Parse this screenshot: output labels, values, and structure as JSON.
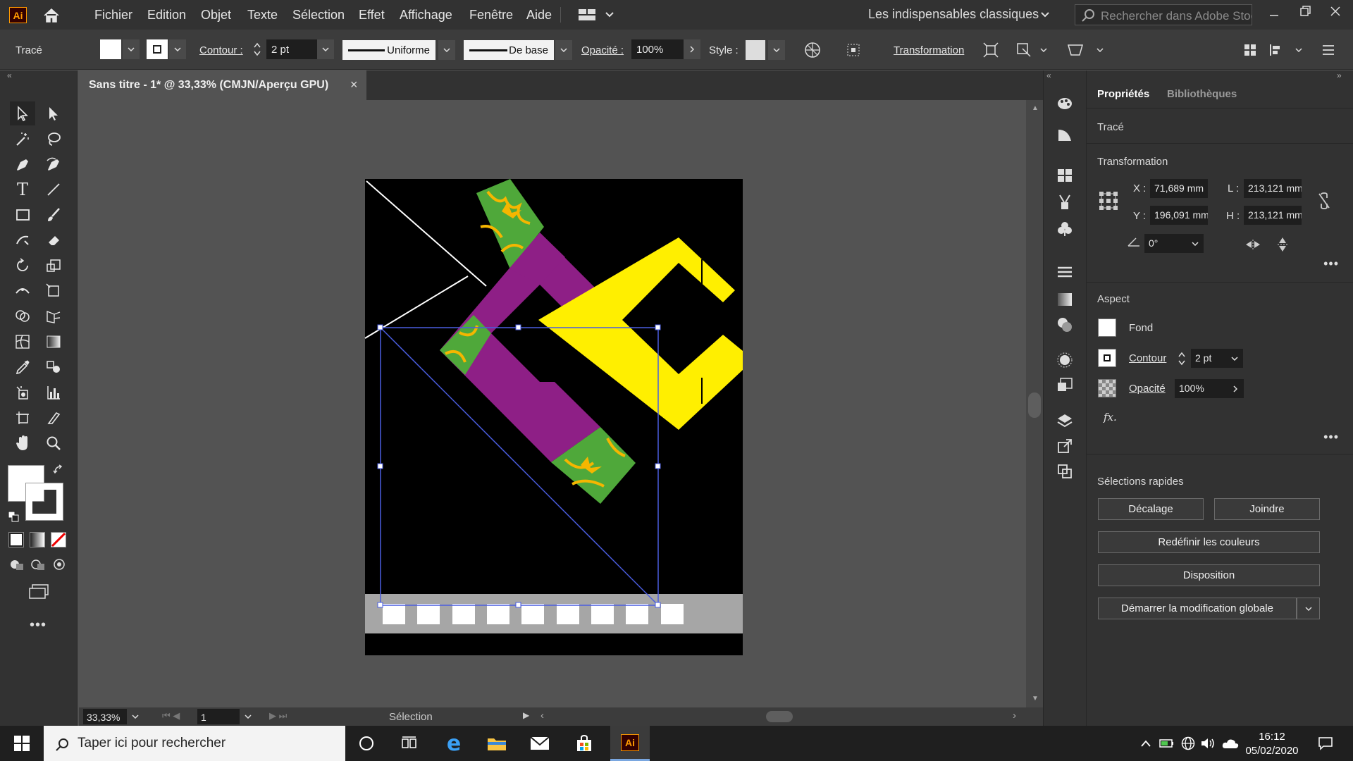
{
  "menu": {
    "logo": "Ai",
    "items": [
      "Fichier",
      "Edition",
      "Objet",
      "Texte",
      "Sélection",
      "Effet",
      "Affichage",
      "Fenêtre",
      "Aide"
    ],
    "workspace": "Les indispensables classiques",
    "search_placeholder": "Rechercher dans Adobe Stock"
  },
  "control": {
    "object_type": "Tracé",
    "stroke_label": "Contour :",
    "stroke_weight": "2 pt",
    "profile_label": "Uniforme",
    "brush_label": "De base",
    "opacity_label": "Opacité :",
    "opacity_value": "100%",
    "style_label": "Style :",
    "transform_link": "Transformation"
  },
  "document": {
    "tab_title": "Sans titre - 1* @ 33,33% (CMJN/Aperçu GPU)"
  },
  "status": {
    "zoom": "33,33%",
    "artboard": "1",
    "tool": "Sélection"
  },
  "properties": {
    "tab_active": "Propriétés",
    "tab_other": "Bibliothèques",
    "object_type": "Tracé",
    "transform_title": "Transformation",
    "x_label": "X :",
    "x_value": "71,689 mm",
    "y_label": "Y :",
    "y_value": "196,091 mm",
    "l_label": "L :",
    "l_value": "213,121 mm",
    "h_label": "H :",
    "h_value": "213,121 mm",
    "angle_value": "0°",
    "aspect_title": "Aspect",
    "fill_label": "Fond",
    "stroke_label": "Contour",
    "stroke_value": "2 pt",
    "opacity_label": "Opacité",
    "opacity_value": "100%",
    "fx_label": "fx.",
    "quick_title": "Sélections rapides",
    "btn_offset": "Décalage",
    "btn_join": "Joindre",
    "btn_recolor": "Redéfinir les couleurs",
    "btn_arrange": "Disposition",
    "btn_global": "Démarrer la modification globale"
  },
  "taskbar": {
    "search_placeholder": "Taper ici pour rechercher",
    "time": "16:12",
    "date": "05/02/2020",
    "active_app": "Ai"
  },
  "colors": {
    "purple": "#8e1f86",
    "yellow": "#ffef00",
    "green": "#4fa83a",
    "orange": "#f5b600",
    "selection": "#4a5de0",
    "accent_ai": "#ff9a00"
  }
}
